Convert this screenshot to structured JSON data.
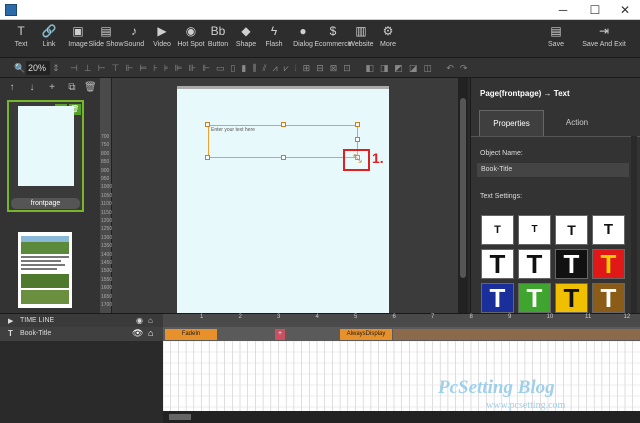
{
  "toolbar": {
    "items": [
      {
        "label": "Text",
        "icon": "T"
      },
      {
        "label": "Link",
        "icon": "🔗"
      },
      {
        "label": "Image",
        "icon": "▣"
      },
      {
        "label": "Slide Show",
        "icon": "▤"
      },
      {
        "label": "Sound",
        "icon": "♪"
      },
      {
        "label": "Video",
        "icon": "▶"
      },
      {
        "label": "Hot Spot",
        "icon": "◉"
      },
      {
        "label": "Button",
        "icon": "Bb"
      },
      {
        "label": "Shape",
        "icon": "◆"
      },
      {
        "label": "Flash",
        "icon": "ϟ"
      },
      {
        "label": "Dialog",
        "icon": "●"
      },
      {
        "label": "Ecommerce",
        "icon": "$"
      },
      {
        "label": "Website",
        "icon": "▥"
      },
      {
        "label": "More",
        "icon": "⚙"
      }
    ],
    "save_label": "Save",
    "save_exit_label": "Save And Exit"
  },
  "zoom": "20%",
  "pages": {
    "current_tag": "frontpage"
  },
  "ruler": {
    "marks": [
      "700",
      "750",
      "800",
      "850",
      "900",
      "950",
      "1000",
      "1050",
      "1100",
      "1150",
      "1200",
      "1250",
      "1300",
      "1350",
      "1400",
      "1450",
      "1500",
      "1550",
      "1600",
      "1650",
      "1700"
    ]
  },
  "canvas": {
    "textbox_placeholder": "Enter your text here",
    "callout_label": "1."
  },
  "right_panel": {
    "breadcrumb": "Page(frontpage) → Text",
    "tabs": [
      "Properties",
      "Action"
    ],
    "object_name_label": "Object Name:",
    "object_name_value": "Book-Title",
    "text_settings_label": "Text Settings:",
    "style_swatches": [
      {
        "bg": "#ffffff",
        "fg": "#111111",
        "size": 11
      },
      {
        "bg": "#ffffff",
        "fg": "#111111",
        "size": 10
      },
      {
        "bg": "#ffffff",
        "fg": "#111111",
        "size": 14
      },
      {
        "bg": "#ffffff",
        "fg": "#111111",
        "size": 15
      },
      {
        "bg": "#ffffff",
        "fg": "#111111",
        "size": 26
      },
      {
        "bg": "#ffffff",
        "fg": "#111111",
        "size": 26
      },
      {
        "bg": "#111111",
        "fg": "#ffffff",
        "size": 26
      },
      {
        "bg": "#e01818",
        "fg": "#f0d000",
        "size": 26
      },
      {
        "bg": "#1a2f9a",
        "fg": "#ffffff",
        "size": 26
      },
      {
        "bg": "#3fa52f",
        "fg": "#ffffff",
        "size": 26
      },
      {
        "bg": "#f0c000",
        "fg": "#111111",
        "size": 26
      },
      {
        "bg": "#8a5c18",
        "fg": "#ffffff",
        "size": 26
      }
    ]
  },
  "timeline": {
    "label": "TIME LINE",
    "layer_name": "Book-Title",
    "ticks": [
      "1",
      "2",
      "3",
      "4",
      "5",
      "6",
      "7",
      "8",
      "9",
      "10",
      "11",
      "12"
    ],
    "segments": [
      {
        "label": "FadeIn",
        "color": "#e8902a"
      },
      {
        "label": "+",
        "color": "#c85060"
      },
      {
        "label": "AlwaysDisplay",
        "color": "#e8902a"
      }
    ]
  },
  "watermark": {
    "name": "PcSetting Blog",
    "url": "www.pcsetting.com"
  },
  "colors": {
    "accent_green": "#77b62a",
    "selection_orange": "#f0a030",
    "callout_red": "#e02020"
  }
}
